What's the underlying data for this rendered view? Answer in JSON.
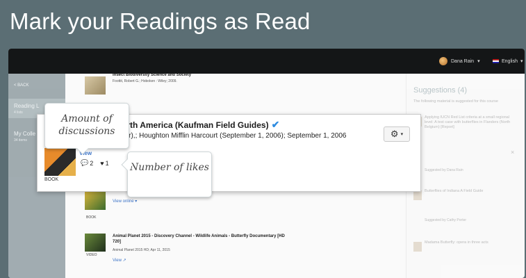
{
  "title": "Mark your Readings as Read",
  "topbar": {
    "user_name": "Dana Rain",
    "user_caret": "▾",
    "language": "English",
    "language_caret": "▾"
  },
  "sidebar": {
    "back_label": "< BACK",
    "items": [
      {
        "label": "Reading L",
        "sub": "4 lists"
      },
      {
        "label": "My Colle",
        "sub": "34 items"
      }
    ]
  },
  "main": {
    "records": [
      {
        "title": "Insect Biodiversity Science and Society",
        "meta": "Foottit, Robert G.; Hoboken : Wiley; 2009.",
        "type": ""
      },
      {
        "title": "",
        "meta": "",
        "type": "BOOK",
        "link": "View online ▾"
      },
      {
        "title": "Animal Planet 2015 - Discovery Channel - Wildlife Animals - Butterfly Documentary [HD 720]",
        "meta": "Animal Planet 2015 HD; Apr 11, 2015",
        "type": "VIDEO",
        "link": "View ↗"
      }
    ]
  },
  "focus": {
    "title": "f North America (Kaufman Field Guides)",
    "check": "✔",
    "meta": "Author),; Houghton Mifflin Harcourt (September 1, 2006); September 1, 2006",
    "view": "View",
    "discussions": "2",
    "likes": "1",
    "type": "BOOK",
    "gear": "⚙",
    "gear_caret": "▾"
  },
  "suggestions": {
    "title": "Suggestions (4)",
    "subtitle": "The following material is suggested for this course",
    "items": [
      {
        "text": "Applying IUCN Red List criteria at a small regional level: A test case with butterflies in Flanders (North Belgium) [Report]",
        "note": "Suggested by Dana Rain"
      },
      {
        "text": "Butterflies of Indiana A Field Guide",
        "note": "Suggested by Cathy Porter"
      },
      {
        "text": "Madama Butterfly: opera in three acts",
        "note": ""
      }
    ],
    "close": "×"
  },
  "callouts": {
    "discussions": "Amount of discussions",
    "likes": "Number of likes"
  },
  "colors": {
    "background": "#5b6e74",
    "topbar": "#141617",
    "link": "#3d74c7",
    "check": "#2f8ce0"
  }
}
